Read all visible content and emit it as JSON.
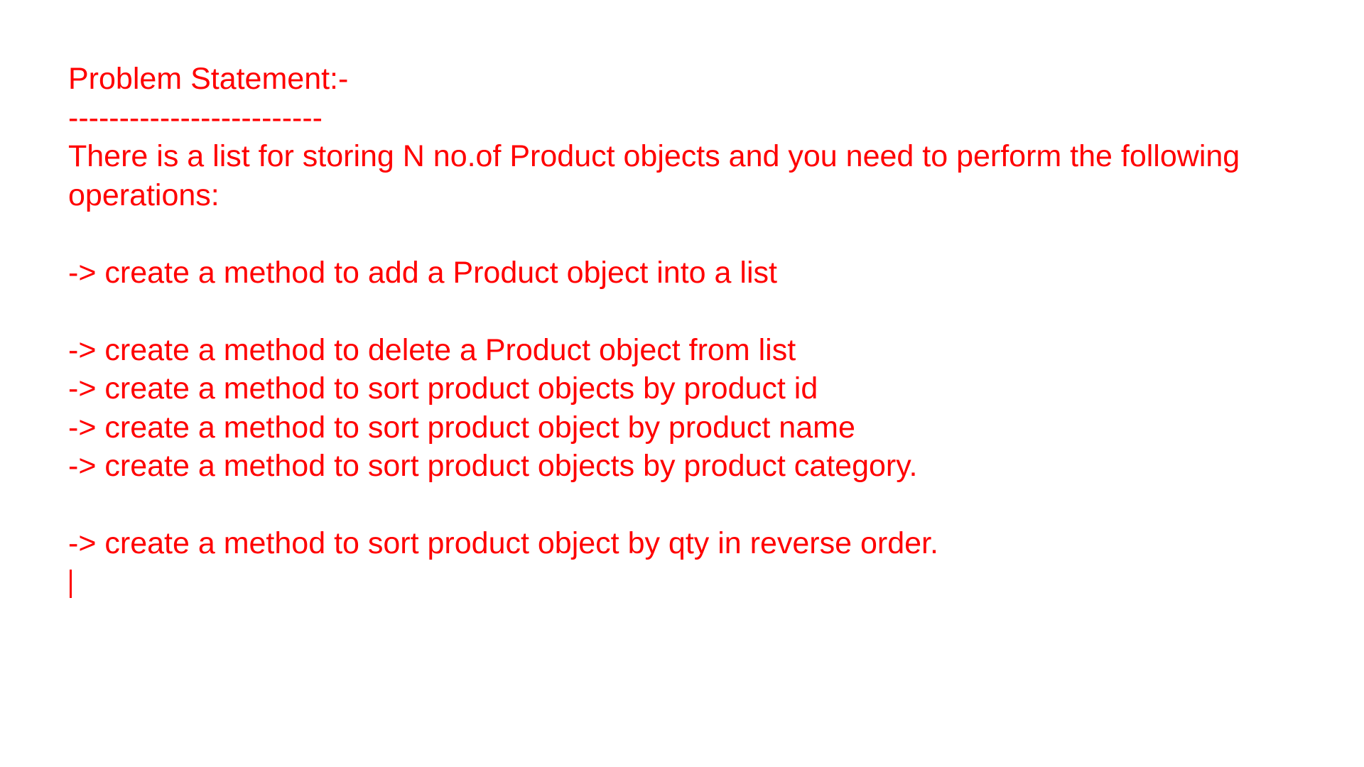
{
  "document": {
    "text_color": "#ff0000",
    "background": "#ffffff",
    "heading": "Problem Statement:-",
    "separator": "-------------------------",
    "intro_line_1": "There is a list for storing N no.of Product objects and you need to perform the following",
    "intro_line_2": "operations:",
    "items": [
      "-> create a method to add a Product object into a list",
      "-> create a method to delete a Product object from list",
      "-> create a method to sort product objects by product id",
      "-> create a method to sort product object by product name",
      "-> create a method to sort product objects by product category.",
      "-> create a method to sort product object by qty in reverse order."
    ]
  }
}
